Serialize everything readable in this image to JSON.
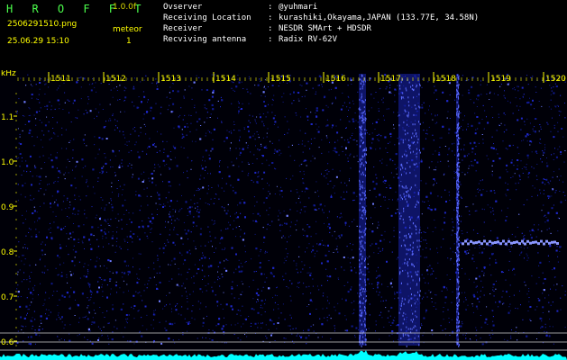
{
  "header": {
    "app_title": "H R O F F T",
    "version": "1.0.0f",
    "filename": "2506291510.png",
    "mode": "meteor",
    "datetime": "25.06.29 15:10",
    "count": "1",
    "info": [
      {
        "key": "Ovserver",
        "colon": ":",
        "value": "@yuhmari"
      },
      {
        "key": "Receiving Location",
        "colon": ":",
        "value": "kurashiki,Okayama,JAPAN (133.77E, 34.58N)"
      },
      {
        "key": "Receiver",
        "colon": ":",
        "value": "NESDR SMArt + HDSDR"
      },
      {
        "key": "Recviving antenna",
        "colon": ":",
        "value": "Radix RV-62V"
      }
    ]
  },
  "axes": {
    "y_unit": "kHz",
    "y_ticks": [
      "1.1",
      "1.0",
      "0.9",
      "0.8",
      "0.7",
      "0.6"
    ],
    "time_ticks": [
      "1511",
      "1512",
      "1513",
      "1514",
      "1515",
      "1516",
      "1517",
      "1518",
      "1519",
      "1520"
    ]
  },
  "colors": {
    "background": "#000000",
    "noise": "#1e28c8",
    "tick": "#ffff00",
    "spectrum": "#00ffff"
  }
}
